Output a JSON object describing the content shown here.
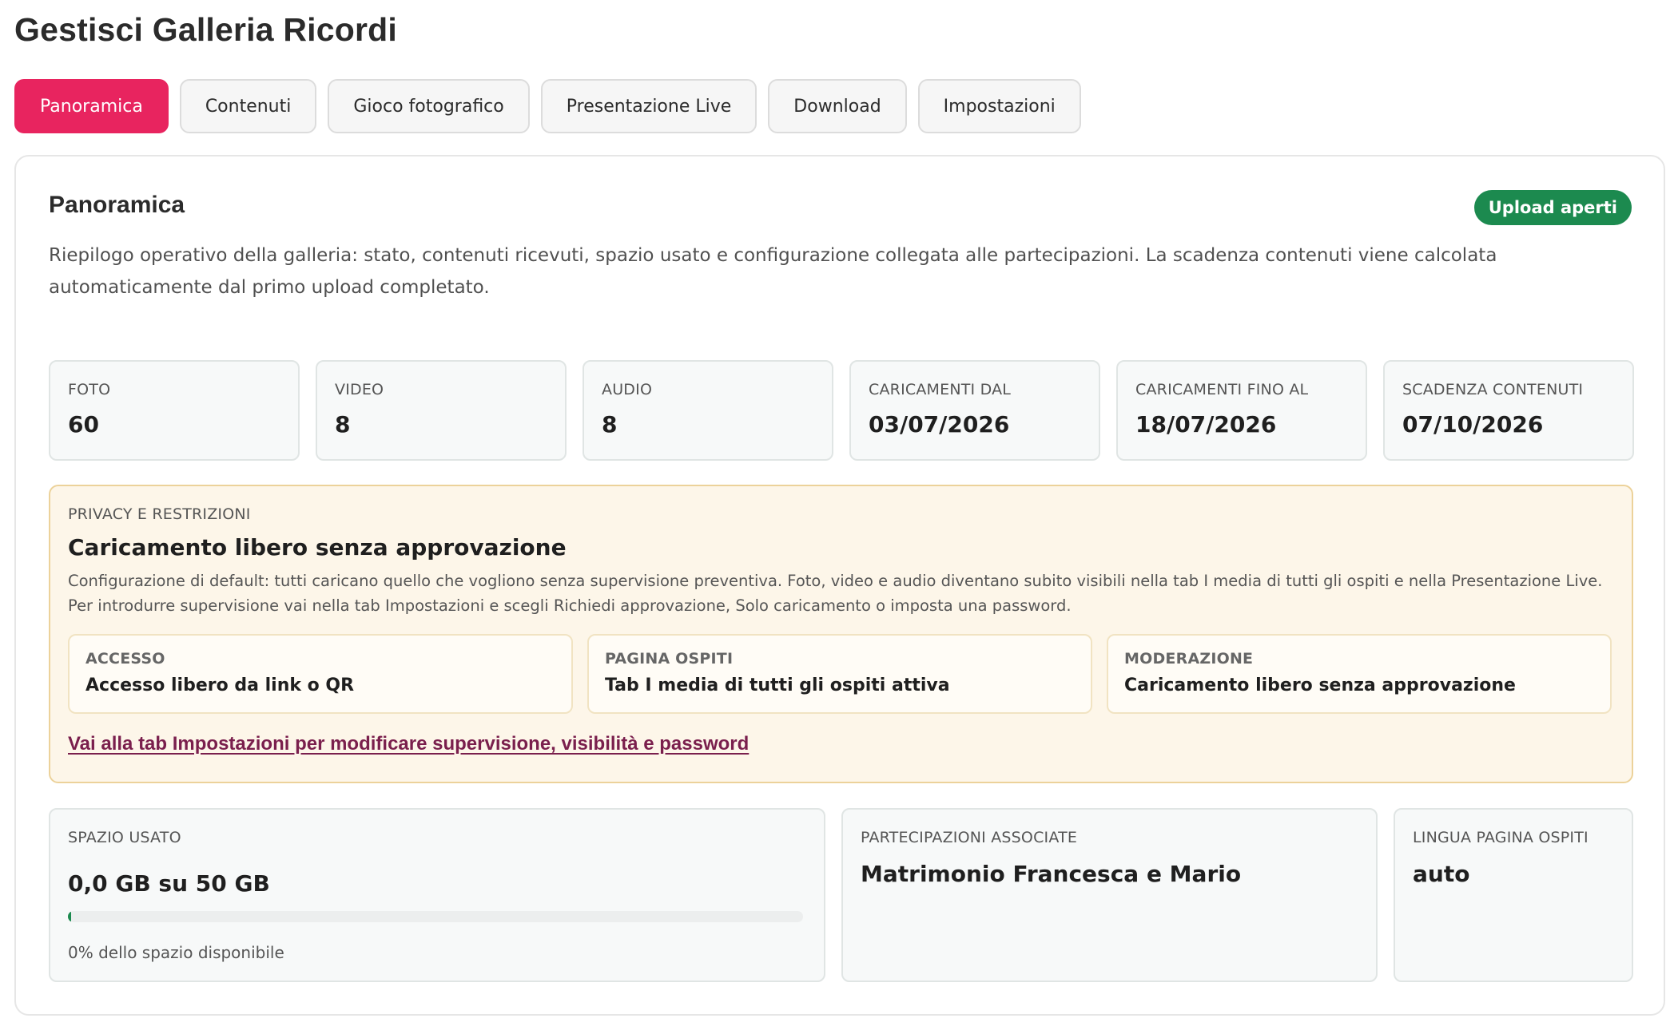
{
  "header": {
    "title": "Gestisci Galleria Ricordi"
  },
  "tabs": [
    {
      "label": "Panoramica",
      "active": true
    },
    {
      "label": "Contenuti",
      "active": false
    },
    {
      "label": "Gioco fotografico",
      "active": false
    },
    {
      "label": "Presentazione Live",
      "active": false
    },
    {
      "label": "Download",
      "active": false
    },
    {
      "label": "Impostazioni",
      "active": false
    }
  ],
  "overview": {
    "title": "Panoramica",
    "badge": "Upload aperti",
    "description": "Riepilogo operativo della galleria: stato, contenuti ricevuti, spazio usato e configurazione collegata alle partecipazioni. La scadenza contenuti viene calcolata automaticamente dal primo upload completato."
  },
  "stats": [
    {
      "label": "Foto",
      "value": "60"
    },
    {
      "label": "Video",
      "value": "8"
    },
    {
      "label": "Audio",
      "value": "8"
    },
    {
      "label": "Caricamenti dal",
      "value": "03/07/2026"
    },
    {
      "label": "Caricamenti fino al",
      "value": "18/07/2026"
    },
    {
      "label": "Scadenza contenuti",
      "value": "07/10/2026"
    }
  ],
  "privacy": {
    "label": "PRIVACY E RESTRIZIONI",
    "title": "Caricamento libero senza approvazione",
    "description": "Configurazione di default: tutti caricano quello che vogliono senza supervisione preventiva. Foto, video e audio diventano subito visibili nella tab I media di tutti gli ospiti e nella Presentazione Live. Per introdurre supervisione vai nella tab Impostazioni e scegli Richiedi approvazione, Solo caricamento o imposta una password.",
    "cards": [
      {
        "label": "ACCESSO",
        "value": "Accesso libero da link o QR"
      },
      {
        "label": "PAGINA OSPITI",
        "value": "Tab I media di tutti gli ospiti attiva"
      },
      {
        "label": "MODERAZIONE",
        "value": "Caricamento libero senza approvazione"
      }
    ],
    "link": "Vai alla tab Impostazioni per modificare supervisione, visibilità e password"
  },
  "storage": {
    "label": "SPAZIO USATO",
    "value": "0,0 GB su 50 GB",
    "percent_used": 0,
    "note": "0% dello spazio disponibile"
  },
  "participations": {
    "label": "PARTECIPAZIONI ASSOCIATE",
    "value": "Matrimonio Francesca e Mario"
  },
  "guest_language": {
    "label": "LINGUA PAGINA OSPITI",
    "value": "auto"
  },
  "colors": {
    "accent": "#e8245f",
    "success": "#1c8a4f",
    "link": "#7a1f4d",
    "privacy_bg": "#fdf6e9"
  }
}
